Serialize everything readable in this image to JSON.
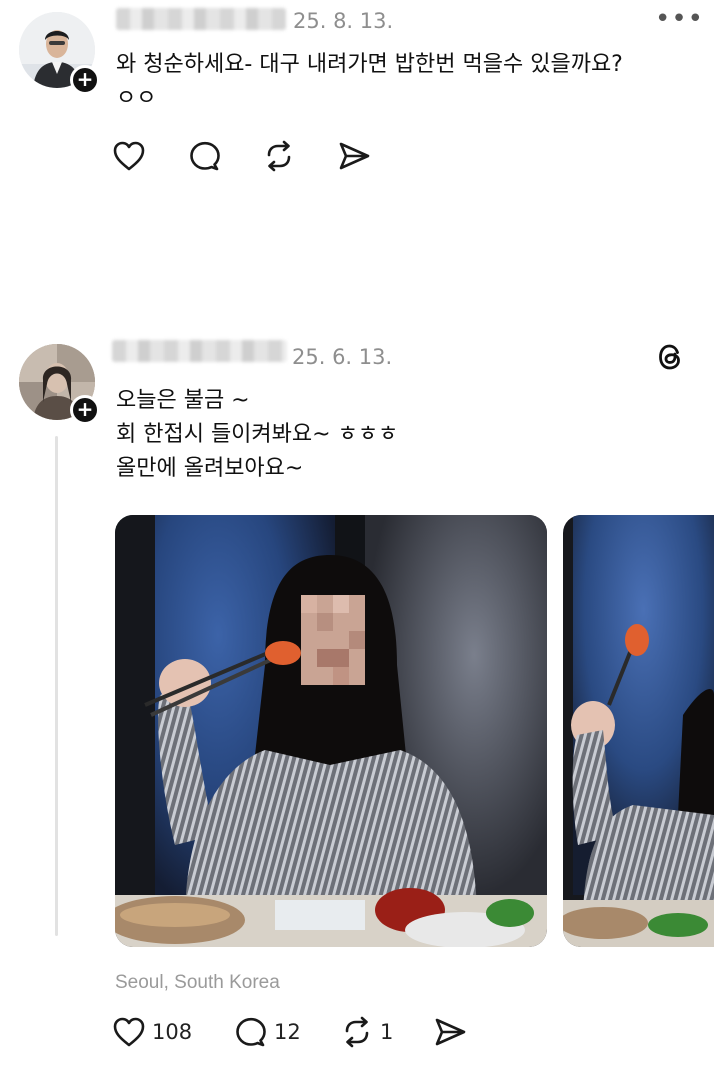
{
  "posts": [
    {
      "date": "25. 8. 13.",
      "more_label": "•••",
      "lines": [
        "와 청순하세요- 대구 내려가면 밥한번 먹을수 있을까요?",
        "ㅇㅇ"
      ],
      "actions": {
        "likes": "",
        "replies": "",
        "reposts": ""
      },
      "icons": [
        "heart-icon",
        "comment-icon",
        "repost-icon",
        "share-icon",
        "more-icon"
      ]
    },
    {
      "date": "25. 6. 13.",
      "lines": [
        "오늘은 불금 ~",
        "회 한접시 들이켜봐요~ ㅎㅎㅎ",
        "올만에 올려보아요~"
      ],
      "location": "Seoul, South Korea",
      "actions": {
        "likes": "108",
        "replies": "12",
        "reposts": "1"
      },
      "icons": [
        "threads-logo-icon",
        "heart-icon",
        "comment-icon",
        "repost-icon",
        "share-icon"
      ]
    }
  ],
  "plus_label": "+",
  "colors": {
    "text": "#111111",
    "muted": "#8e8e8e",
    "badge": "#111111"
  }
}
